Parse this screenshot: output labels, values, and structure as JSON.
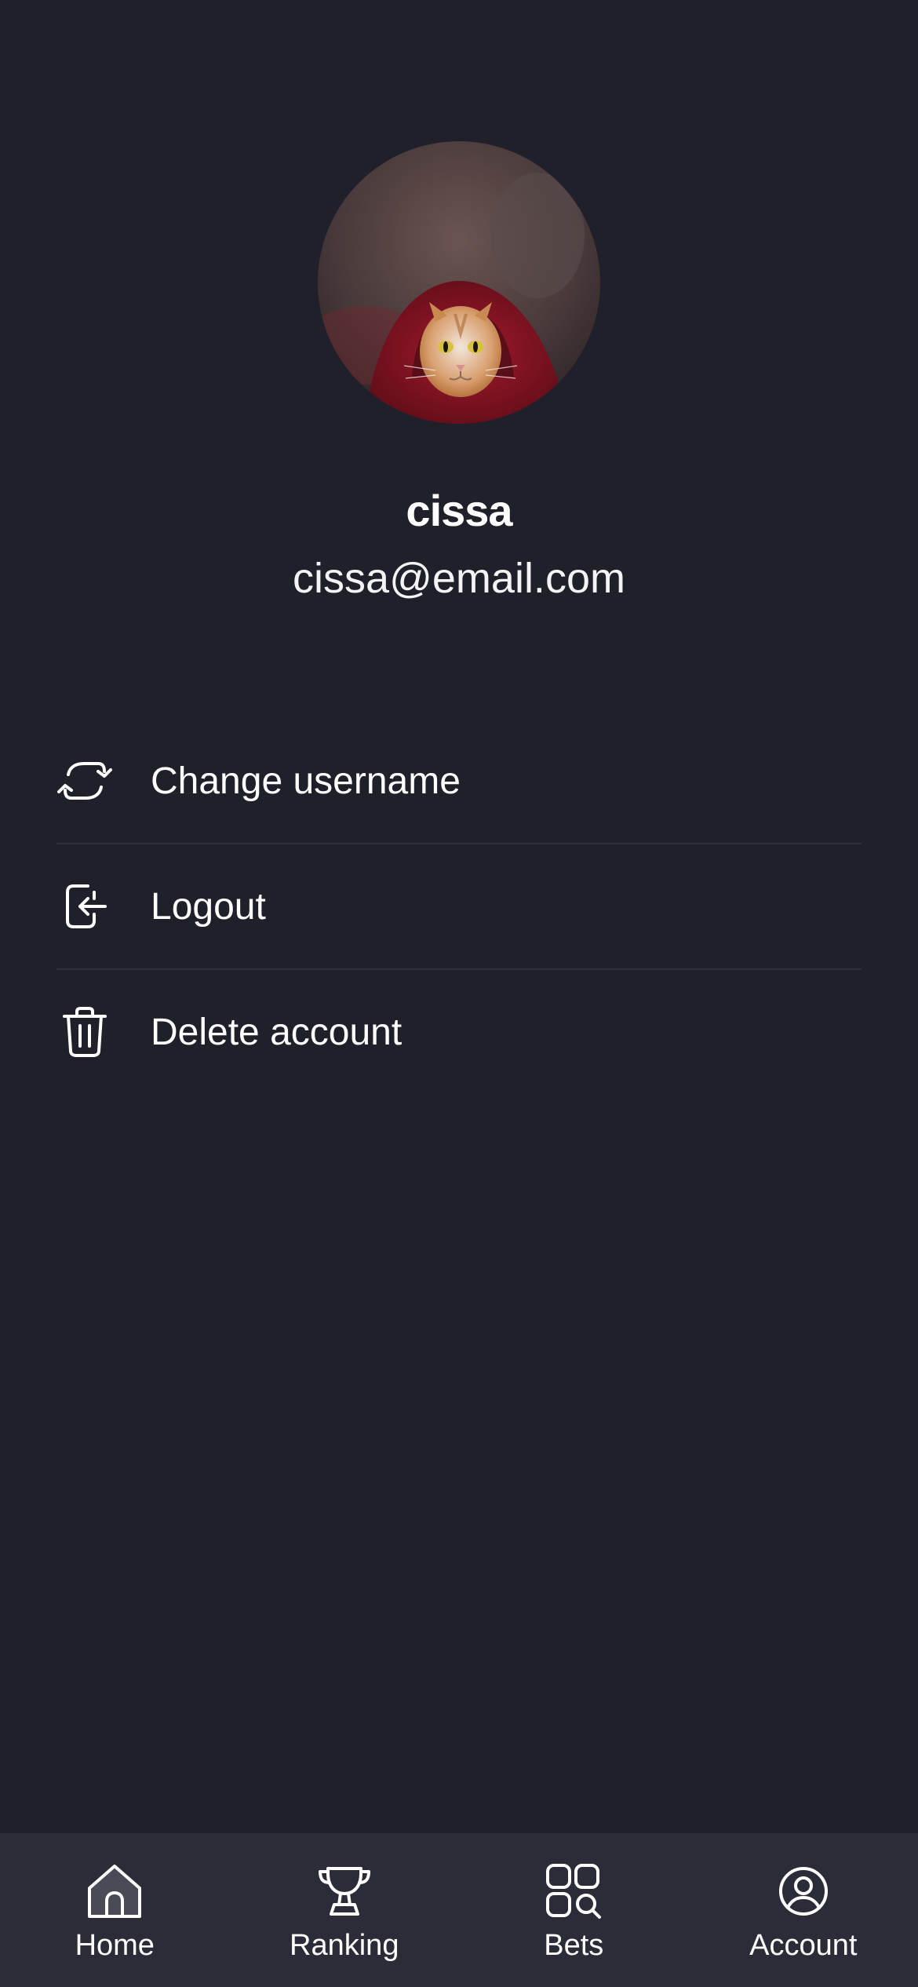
{
  "profile": {
    "username": "cissa",
    "email": "cissa@email.com",
    "avatar_alt": "cat in red hood"
  },
  "menu": {
    "items": [
      {
        "label": "Change username",
        "icon": "refresh-icon"
      },
      {
        "label": "Logout",
        "icon": "logout-icon"
      },
      {
        "label": "Delete account",
        "icon": "trash-icon"
      }
    ]
  },
  "tabbar": {
    "tabs": [
      {
        "label": "Home",
        "icon": "home-icon"
      },
      {
        "label": "Ranking",
        "icon": "trophy-icon"
      },
      {
        "label": "Bets",
        "icon": "bets-grid-icon"
      },
      {
        "label": "Account",
        "icon": "user-circle-icon"
      }
    ],
    "active": "Account"
  },
  "colors": {
    "background": "#20202b",
    "tabbar_background": "#2c2c38",
    "divider": "#2f2f3c",
    "text": "#ffffff"
  }
}
